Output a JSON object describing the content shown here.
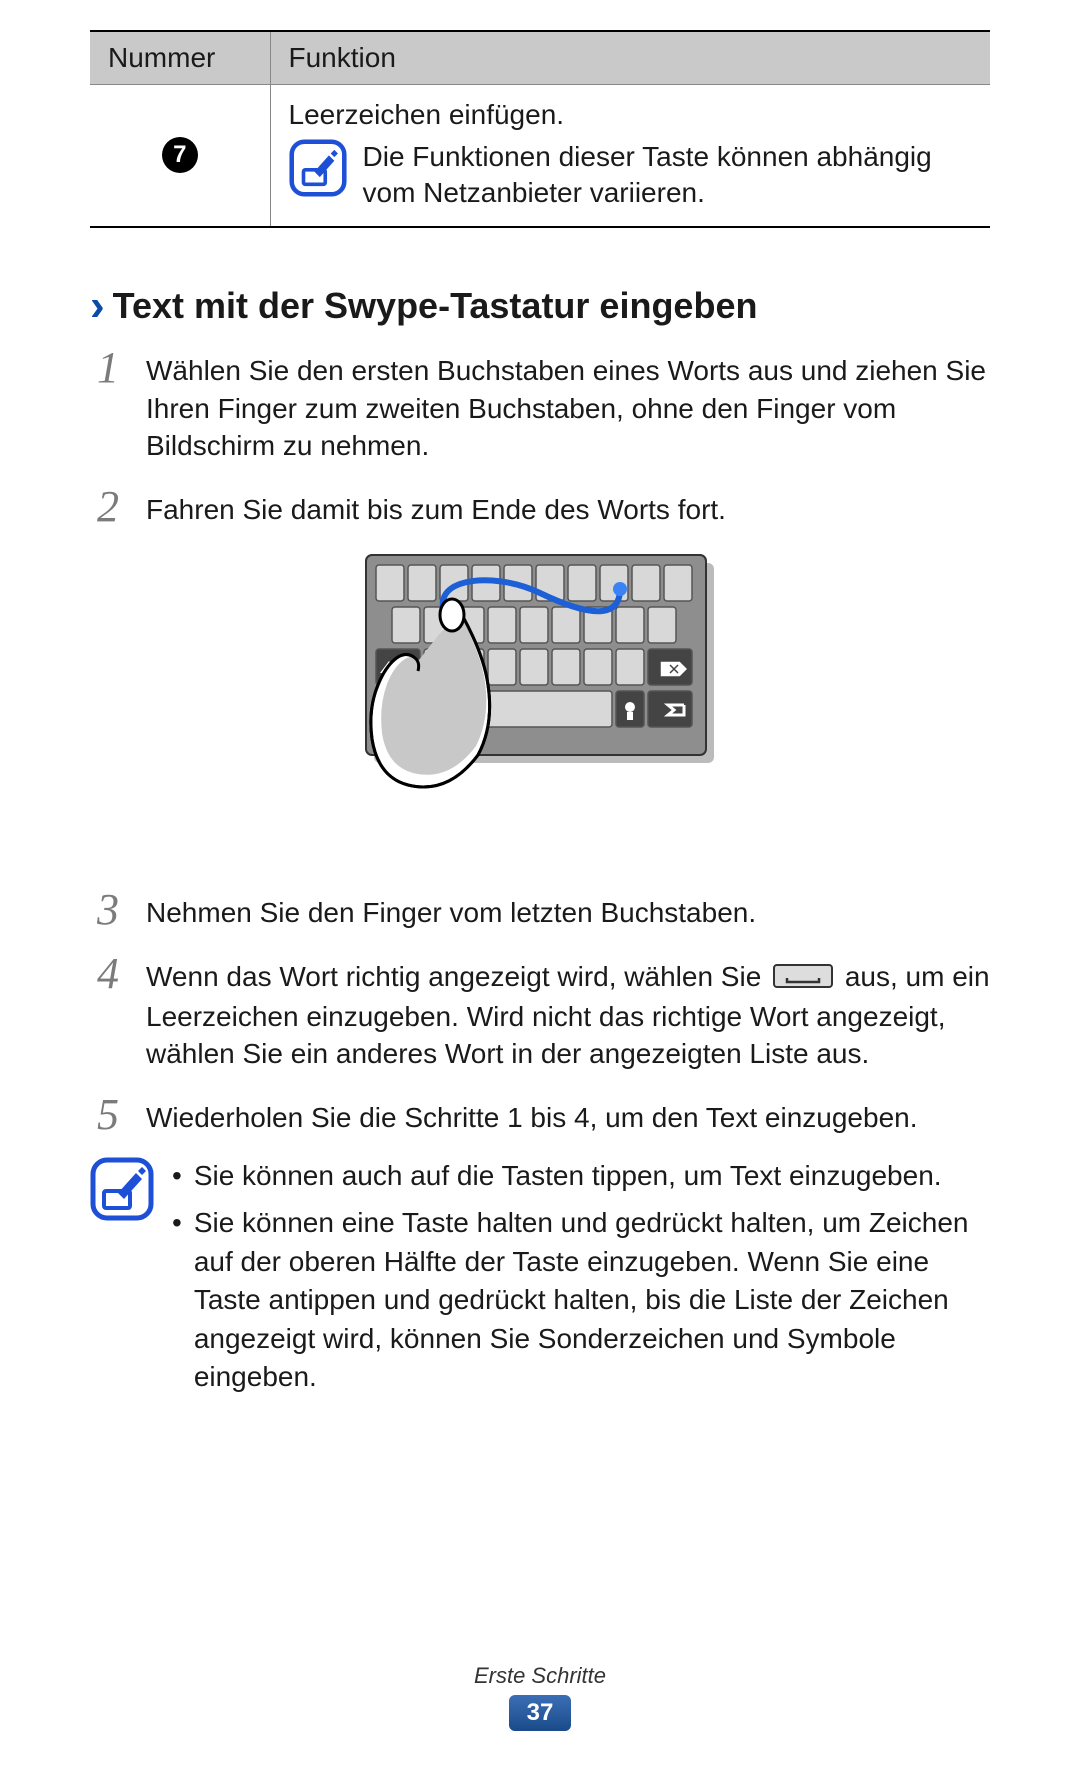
{
  "table": {
    "headers": [
      "Nummer",
      "Funktion"
    ],
    "row": {
      "number": "7",
      "text1": "Leerzeichen einfügen.",
      "note": "Die Funktionen dieser Taste können abhängig vom Netzanbieter variieren."
    }
  },
  "section_title": "Text mit der Swype-Tastatur eingeben",
  "steps": {
    "s1": "Wählen Sie den ersten Buchstaben eines Worts aus und ziehen Sie Ihren Finger zum zweiten Buchstaben, ohne den Finger vom Bildschirm zu nehmen.",
    "s2": "Fahren Sie damit bis zum Ende des Worts fort.",
    "s3": "Nehmen Sie den Finger vom letzten Buchstaben.",
    "s4a": "Wenn das Wort richtig angezeigt wird, wählen Sie ",
    "s4b": " aus, um ein Leerzeichen einzugeben. Wird nicht das richtige Wort angezeigt, wählen Sie ein anderes Wort in der angezeigten Liste aus.",
    "s5": "Wiederholen Sie die Schritte 1 bis 4, um den Text einzugeben."
  },
  "step_nums": {
    "n1": "1",
    "n2": "2",
    "n3": "3",
    "n4": "4",
    "n5": "5"
  },
  "tips": {
    "t1": "Sie können auch auf die Tasten tippen, um Text einzugeben.",
    "t2": "Sie können eine Taste halten und gedrückt halten, um Zeichen auf der oberen Hälfte der Taste einzugeben. Wenn Sie eine Taste antippen und gedrückt halten, bis die Liste der Zeichen angezeigt wird, können Sie Sonderzeichen und Symbole eingeben."
  },
  "footer": {
    "section": "Erste Schritte",
    "page": "37"
  }
}
